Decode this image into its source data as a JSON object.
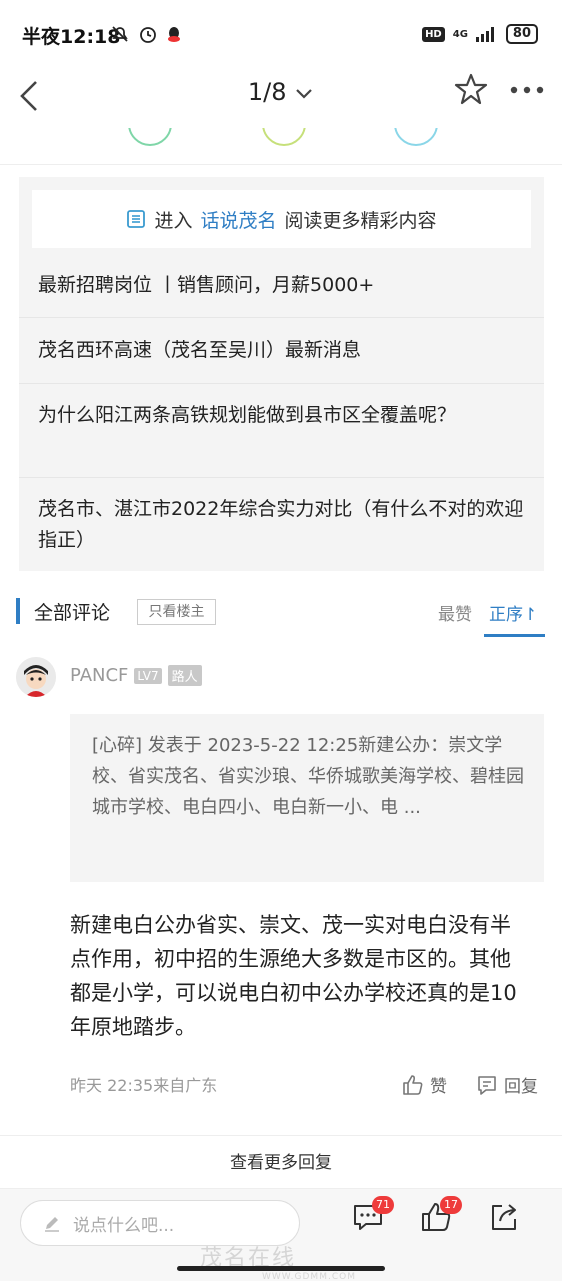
{
  "status_bar": {
    "time": "半夜12:18",
    "network": "4G",
    "battery": "80",
    "hd": "HD"
  },
  "nav": {
    "page_indicator": "1/8"
  },
  "related": {
    "enter_prefix": "进入",
    "enter_keyword": "话说茂名",
    "enter_suffix": "阅读更多精彩内容",
    "items": [
      "最新招聘岗位 丨销售顾问，月薪5000+",
      "茂名西环高速（茂名至吴川）最新消息",
      "为什么阳江两条高铁规划能做到县市区全覆盖呢？",
      "茂名市、湛江市2022年综合实力对比（有什么不对的欢迎指正）"
    ]
  },
  "comments": {
    "title": "全部评论",
    "only_author": "只看楼主",
    "sort_hot": "最赞",
    "sort_order": "正序↾"
  },
  "comment": {
    "username": "PANCF",
    "level": "LV7",
    "role": "路人",
    "quote": "[心碎] 发表于 2023-5-22 12:25新建公办：崇文学校、省实茂名、省实沙琅、华侨城歌美海学校、碧桂园城市学校、电白四小、电白新一小、电 ...",
    "body": "新建电白公办省实、崇文、茂一实对电白没有半点作用，初中招的生源绝大多数是市区的。其他都是小学，可以说电白初中公办学校还真的是10年原地踏步。",
    "meta": "昨天 22:35来自广东",
    "like_label": "赞",
    "reply_label": "回复"
  },
  "more_replies": "查看更多回复",
  "bottom": {
    "placeholder": "说点什么吧...",
    "comment_count": "71",
    "like_count": "17"
  },
  "watermark": {
    "main": "茂名在线",
    "url": "WWW.GDMM.COM"
  },
  "colors": {
    "accent": "#2f7ec4",
    "badge": "#ee3b3b"
  }
}
